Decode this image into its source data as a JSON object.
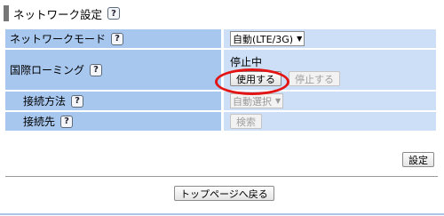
{
  "section": {
    "title": "ネットワーク設定"
  },
  "help_glyph": "?",
  "rows": {
    "network_mode": {
      "label": "ネットワークモード",
      "selected": "自動(LTE/3G)"
    },
    "roaming": {
      "label": "国際ローミング",
      "status": "停止中",
      "use_label": "使用する",
      "stop_label": "停止する"
    },
    "conn_method": {
      "label": "接続方法",
      "selected": "自動選択"
    },
    "conn_target": {
      "label": "接続先",
      "search_label": "検索"
    }
  },
  "buttons": {
    "set": "設定",
    "back": "トップページへ戻る"
  },
  "colors": {
    "label_bg": "#a7c7ee",
    "value_bg": "#cddff6",
    "highlight": "#e31414"
  }
}
